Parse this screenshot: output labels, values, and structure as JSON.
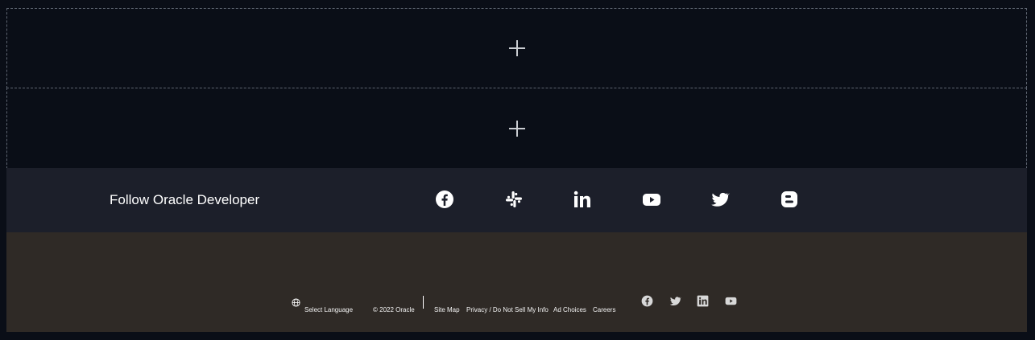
{
  "add_blocks": [
    {
      "label": "+"
    },
    {
      "label": "+"
    }
  ],
  "follow": {
    "title": "Follow Oracle Developer",
    "icons": [
      "facebook-icon",
      "slack-icon",
      "linkedin-icon",
      "youtube-icon",
      "twitter-icon",
      "blogger-icon"
    ]
  },
  "footer": {
    "language": "Select Language",
    "copyright": "© 2022 Oracle",
    "links": [
      "Site Map",
      "Privacy / Do Not Sell My Info",
      "Ad Choices",
      "Careers"
    ],
    "social_icons": [
      "facebook-icon",
      "twitter-icon",
      "linkedin-icon",
      "youtube-icon"
    ]
  },
  "colors": {
    "page_bg": "#0a0e17",
    "follow_bg": "#1c1f2a",
    "footer_bg": "#2f2a26",
    "text": "#ffffff"
  }
}
